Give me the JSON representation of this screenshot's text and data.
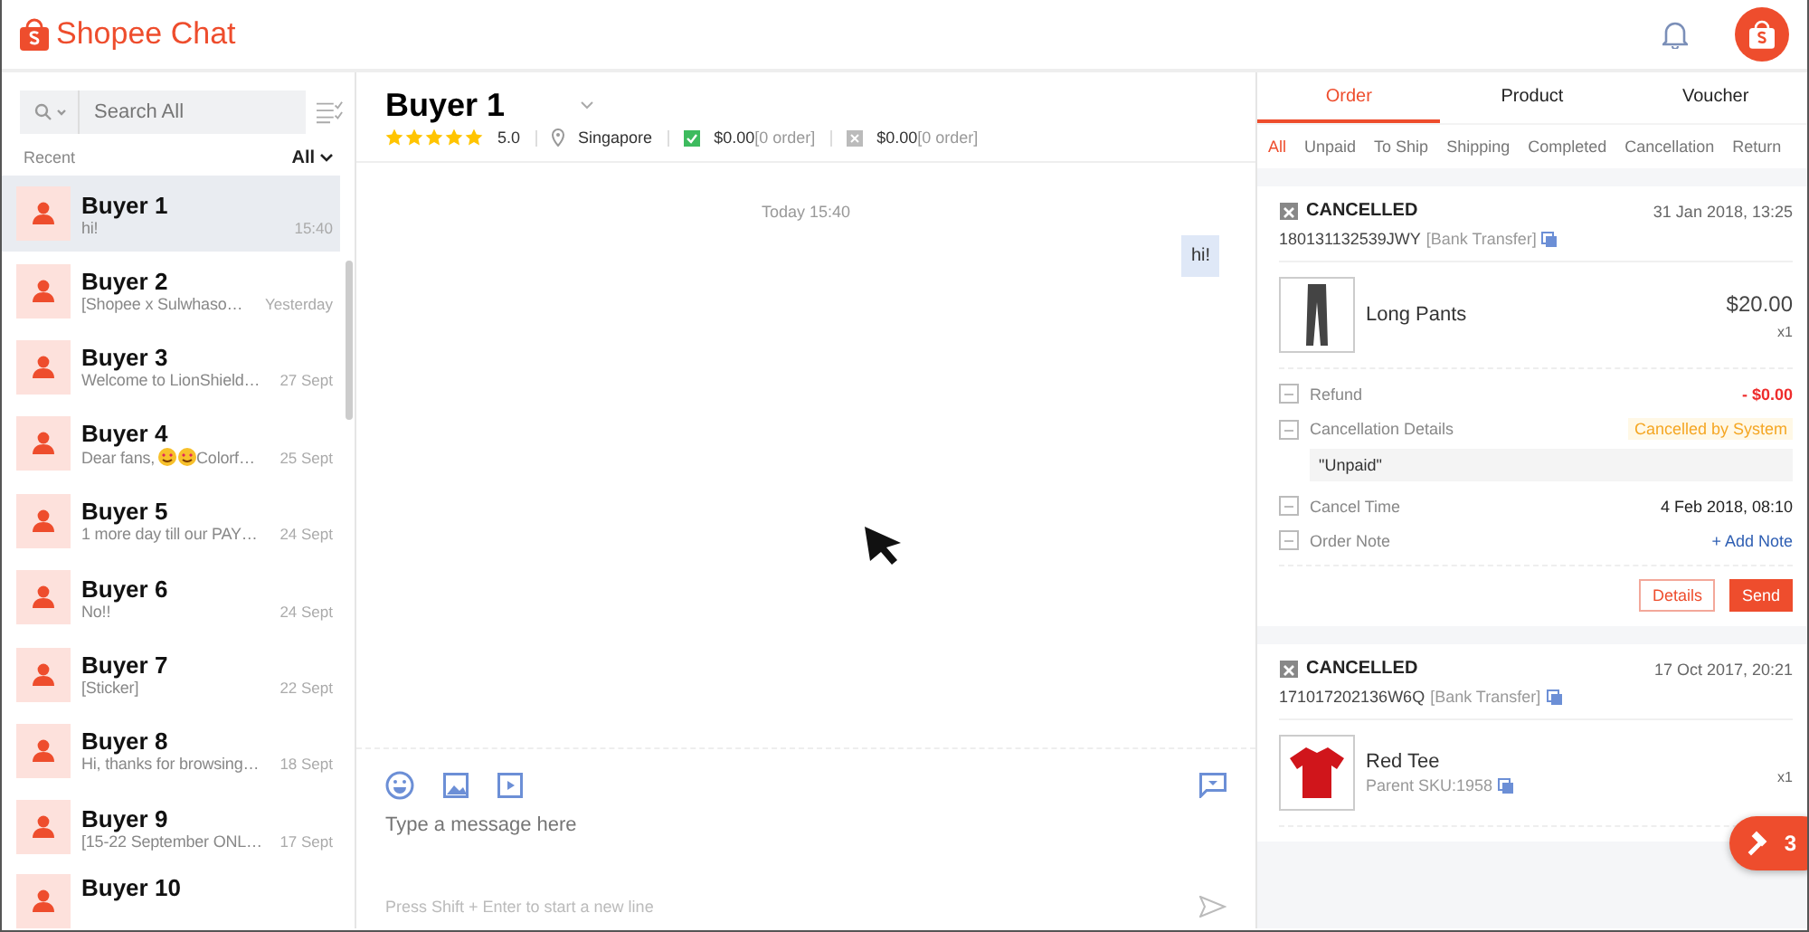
{
  "app": {
    "title": "Shopee Chat"
  },
  "sidebar": {
    "search": {
      "placeholder": "Search All"
    },
    "section_label": "Recent",
    "filter": "All",
    "conversations": [
      {
        "name": "Buyer 1",
        "preview": [
          {
            "kind": "text",
            "text": "hi!"
          }
        ],
        "time": "15:40",
        "selected": true
      },
      {
        "name": "Buyer 2",
        "preview": [
          {
            "kind": "text",
            "text": "[Shopee x Sulwhaso…"
          }
        ],
        "time": "Yesterday",
        "selected": false
      },
      {
        "name": "Buyer 3",
        "preview": [
          {
            "kind": "text",
            "text": "Welcome to LionShield…"
          }
        ],
        "time": "27 Sept",
        "selected": false
      },
      {
        "name": "Buyer 4",
        "preview": [
          {
            "kind": "text",
            "text": "Dear fans, "
          },
          {
            "kind": "emoji"
          },
          {
            "kind": "emoji"
          },
          {
            "kind": "text",
            "text": "Colorf…"
          }
        ],
        "time": "25 Sept",
        "selected": false
      },
      {
        "name": "Buyer 5",
        "preview": [
          {
            "kind": "text",
            "text": "1 more day till our PAY…"
          }
        ],
        "time": "24 Sept",
        "selected": false
      },
      {
        "name": "Buyer 6",
        "preview": [
          {
            "kind": "text",
            "text": "No!!"
          }
        ],
        "time": "24 Sept",
        "selected": false
      },
      {
        "name": "Buyer 7",
        "preview": [
          {
            "kind": "text",
            "text": "[Sticker]"
          }
        ],
        "time": "22 Sept",
        "selected": false
      },
      {
        "name": "Buyer 8",
        "preview": [
          {
            "kind": "text",
            "text": "Hi, thanks for browsing…"
          }
        ],
        "time": "18 Sept",
        "selected": false
      },
      {
        "name": "Buyer 9",
        "preview": [
          {
            "kind": "text",
            "text": "[15-22 September ONL…"
          }
        ],
        "time": "17 Sept",
        "selected": false
      },
      {
        "name": "Buyer 10",
        "selected": false
      }
    ]
  },
  "chat": {
    "buyer_name": "Buyer 1",
    "stars": 5,
    "rating": "5.0",
    "location": "Singapore",
    "completed_amount": "$0.00",
    "completed_orders": "[0 order]",
    "cancelled_amount": "$0.00",
    "cancelled_orders": "[0 order]",
    "messages": [
      {
        "kind": "timestamp",
        "text": "Today 15:40"
      },
      {
        "kind": "outgoing",
        "text": "hi!"
      }
    ],
    "composer": {
      "placeholder": "Type a message here",
      "hint": "Press Shift + Enter to start a new line"
    }
  },
  "panel": {
    "tabs": [
      {
        "label": "Order",
        "selected": true
      },
      {
        "label": "Product",
        "selected": false
      },
      {
        "label": "Voucher",
        "selected": false
      }
    ],
    "filters": [
      {
        "label": "All",
        "selected": true
      },
      {
        "label": "Unpaid",
        "selected": false
      },
      {
        "label": "To Ship",
        "selected": false
      },
      {
        "label": "Shipping",
        "selected": false
      },
      {
        "label": "Completed",
        "selected": false
      },
      {
        "label": "Cancellation",
        "selected": false
      },
      {
        "label": "Return",
        "selected": false
      }
    ],
    "orders": [
      {
        "status": "CANCELLED",
        "date": "31 Jan 2018, 13:25",
        "order_id": "180131132539JWY",
        "payment": "[Bank Transfer]",
        "items": [
          {
            "kind": "pants",
            "name": "Long Pants",
            "price": "$20.00",
            "qty": "x1"
          }
        ],
        "details": [
          {
            "kind": "amount",
            "label": "Refund",
            "value": "- $0.00"
          },
          {
            "kind": "badge",
            "label": "Cancellation Details",
            "value": "Cancelled by System",
            "reason": "\"Unpaid\""
          },
          {
            "kind": "plain",
            "label": "Cancel Time",
            "value": "4 Feb 2018, 08:10"
          },
          {
            "kind": "link",
            "label": "Order Note",
            "value": "+ Add Note"
          }
        ],
        "buttons": [
          {
            "kind": "outline",
            "label": "Details"
          },
          {
            "kind": "solid",
            "label": "Send"
          }
        ]
      },
      {
        "status": "CANCELLED",
        "date": "17 Oct 2017, 20:21",
        "order_id": "171017202136W6Q",
        "payment": "[Bank Transfer]",
        "items": [
          {
            "kind": "tee",
            "name": "Red Tee",
            "sku": "Parent SKU:1958",
            "qty": "x1"
          }
        ]
      }
    ]
  },
  "floating_button": {
    "count": "3"
  }
}
